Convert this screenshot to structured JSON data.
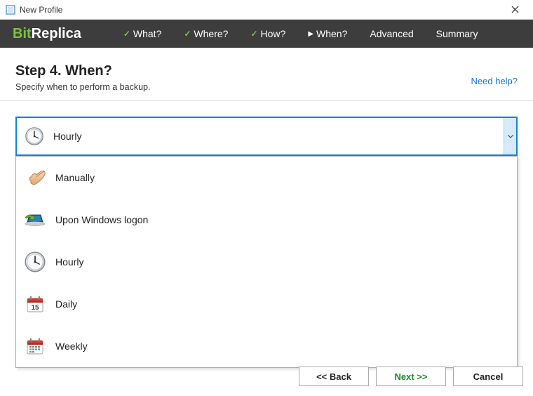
{
  "window": {
    "title": "New Profile"
  },
  "logo": {
    "bit": "Bit",
    "replica": "Replica"
  },
  "nav": {
    "what": "What?",
    "where": "Where?",
    "how": "How?",
    "when": "When?",
    "advanced": "Advanced",
    "summary": "Summary"
  },
  "step": {
    "title": "Step 4. When?",
    "subtitle": "Specify when to perform a backup.",
    "help": "Need help?"
  },
  "combo": {
    "selected": "Hourly"
  },
  "options": {
    "0": {
      "label": "Manually"
    },
    "1": {
      "label": "Upon Windows logon"
    },
    "2": {
      "label": "Hourly"
    },
    "3": {
      "label": "Daily"
    },
    "4": {
      "label": "Weekly"
    }
  },
  "buttons": {
    "back": "<< Back",
    "next": "Next >>",
    "cancel": "Cancel"
  }
}
